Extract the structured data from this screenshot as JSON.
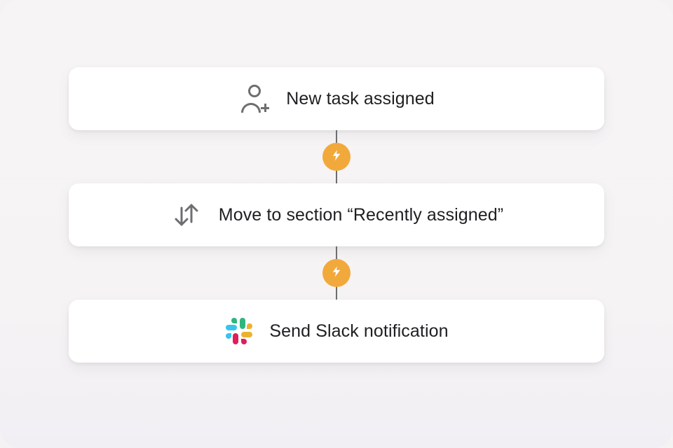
{
  "workflow": {
    "steps": [
      {
        "id": "trigger",
        "icon": "person-plus",
        "label": "New task assigned"
      },
      {
        "id": "action-move",
        "icon": "swap-arrows",
        "label": "Move to section “Recently assigned”"
      },
      {
        "id": "action-slack",
        "icon": "slack-logo",
        "label": "Send Slack notification"
      }
    ],
    "connector_icon": "lightning-bolt"
  },
  "colors": {
    "card_bg": "#ffffff",
    "canvas_bg": "#f5f3f4",
    "text": "#1e1f21",
    "icon_stroke": "#6d6e70",
    "connector_badge": "#f2a93b",
    "slack_green": "#2eb67d",
    "slack_blue": "#36c5f0",
    "slack_red": "#e01e5a",
    "slack_yellow": "#ecb22e"
  }
}
